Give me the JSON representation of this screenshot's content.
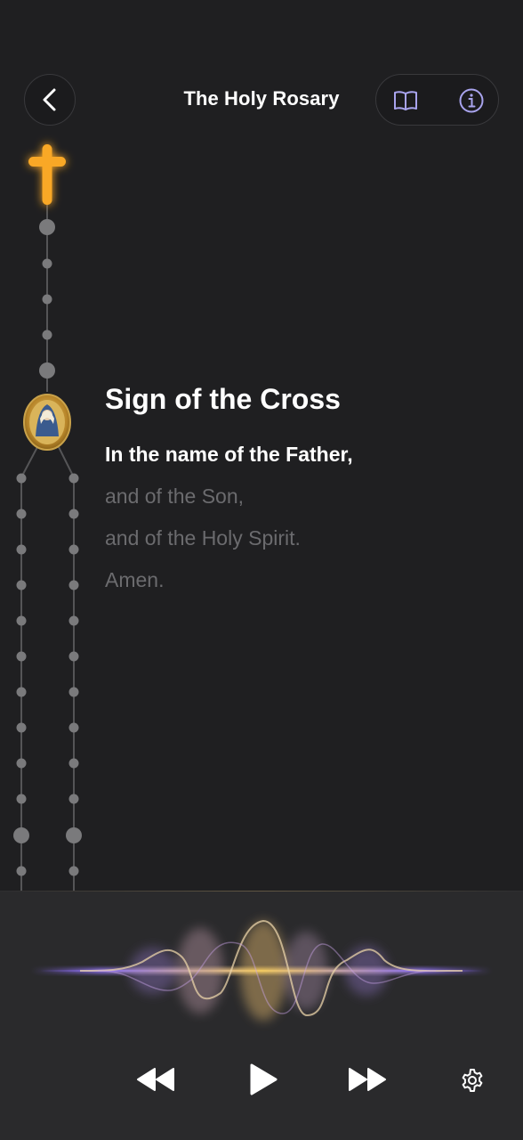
{
  "header": {
    "title": "The Holy Rosary",
    "back_icon": "chevron-left-icon",
    "book_icon": "book-open-icon",
    "info_icon": "info-icon"
  },
  "prayer": {
    "title": "Sign of the Cross",
    "lines": [
      {
        "text": "In the name of the Father,",
        "active": true
      },
      {
        "text": "and of the Son,",
        "active": false
      },
      {
        "text": "and of the Holy Spirit.",
        "active": false
      },
      {
        "text": "Amen.",
        "active": false
      }
    ]
  },
  "player": {
    "controls": [
      "rewind-icon",
      "play-icon",
      "fast-forward-icon",
      "gear-icon"
    ]
  },
  "colors": {
    "background": "#1f1f21",
    "accent_gold": "#f7a52a",
    "accent_purple": "#9b7fe0",
    "bead": "#7a7a7c"
  }
}
